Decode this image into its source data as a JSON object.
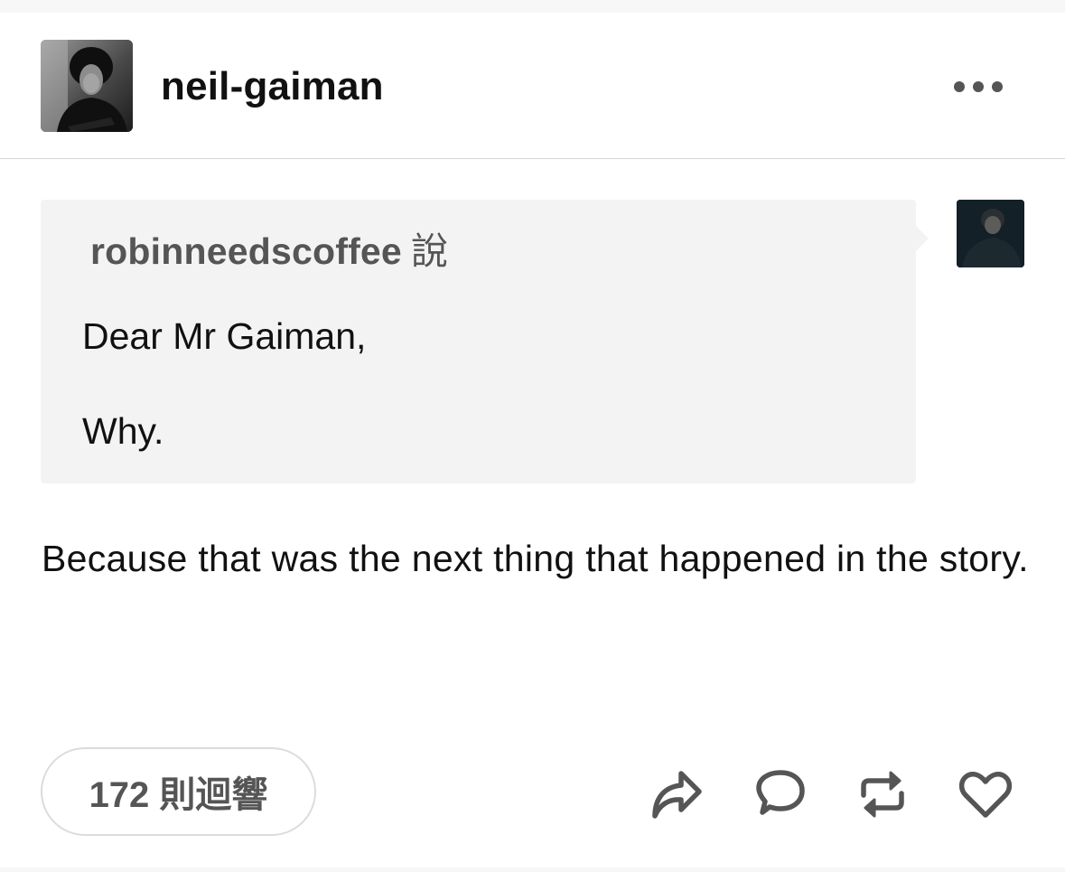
{
  "post": {
    "blog_name": "neil-gaiman",
    "asker": {
      "name": "robinneedscoffee",
      "said_label": "說"
    },
    "question": {
      "line1": "Dear Mr Gaiman,",
      "line2": "Why."
    },
    "answer": "Because that was the next thing that happened in the story.",
    "notes_label": "172 則迴響"
  },
  "icons": {
    "more": "more-horizontal-icon",
    "share": "share-icon",
    "reply": "comment-icon",
    "reblog": "reblog-icon",
    "like": "heart-icon"
  },
  "colors": {
    "quote_background": "#f3f3f3",
    "icon_color": "#555555",
    "border_color": "#dcdcdc"
  }
}
